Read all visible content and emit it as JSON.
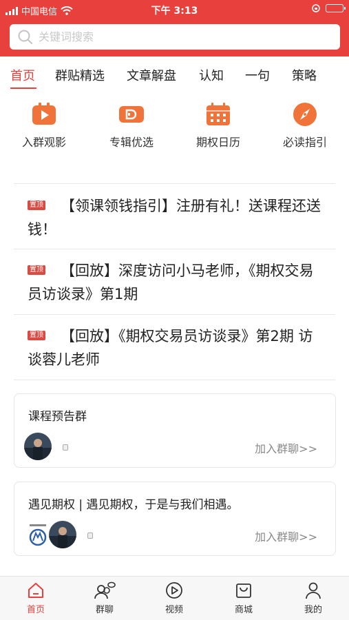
{
  "status_bar": {
    "carrier": "中国电信",
    "time": "下午 3:13"
  },
  "search": {
    "placeholder": "关键词搜索"
  },
  "tabs": [
    {
      "label": "首页",
      "active": true
    },
    {
      "label": "群贴精选"
    },
    {
      "label": "文章解盘"
    },
    {
      "label": "认知"
    },
    {
      "label": "一句"
    },
    {
      "label": "策略"
    }
  ],
  "quick_links": [
    {
      "label": "入群观影",
      "icon": "play-icon"
    },
    {
      "label": "专辑优选",
      "icon": "album-icon"
    },
    {
      "label": "期权日历",
      "icon": "calendar-icon"
    },
    {
      "label": "必读指引",
      "icon": "compass-icon"
    }
  ],
  "news": [
    {
      "tag": "置顶",
      "title": "【领课领钱指引】注册有礼！送课程还送钱！"
    },
    {
      "tag": "置顶",
      "title": "【回放】深度访问小马老师，《期权交易员访谈录》第1期"
    },
    {
      "tag": "置顶",
      "title": "【回放】《期权交易员访谈录》第2期 访谈蓉儿老师"
    }
  ],
  "groups": [
    {
      "title": "课程预告群",
      "join": "加入群聊>>"
    },
    {
      "title": "遇见期权 | 遇见期权，于是与我们相遇。",
      "join": "加入群聊>>"
    }
  ],
  "bottom_nav": [
    {
      "label": "首页",
      "active": true
    },
    {
      "label": "群聊"
    },
    {
      "label": "视频"
    },
    {
      "label": "商城"
    },
    {
      "label": "我的"
    }
  ],
  "colors": {
    "accent": "#e8403c",
    "tag": "#d94a43",
    "orange": "#f0743a"
  }
}
